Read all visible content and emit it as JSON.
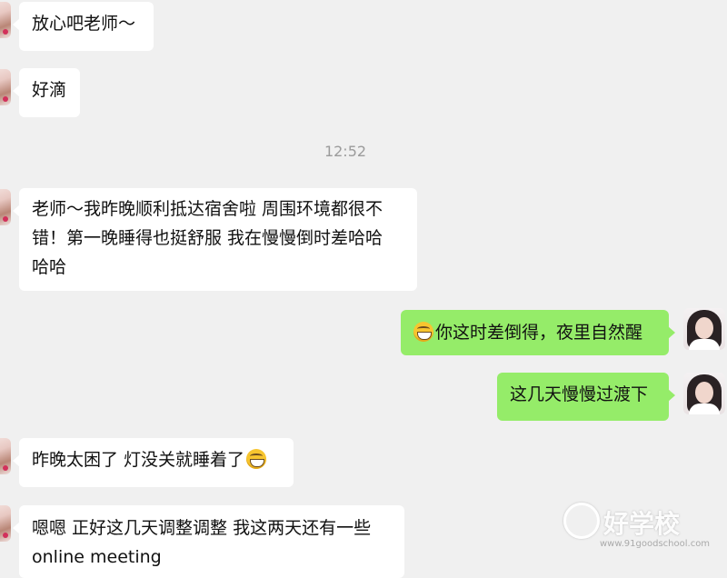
{
  "chat": {
    "timestamp": "12:52",
    "messages": [
      {
        "side": "left",
        "text": "放心吧老师～"
      },
      {
        "side": "left",
        "text": "好滴"
      },
      {
        "side": "left",
        "text_line1": "老师～我昨晚顺利抵达宿舍啦 周围环境都很不",
        "text_line2": "错！第一晚睡得也挺舒服 我在慢慢倒时差哈哈",
        "text_line3": "哈哈"
      },
      {
        "side": "right",
        "emoji": "grinning-face-emoji",
        "text": "你这时差倒得，夜里自然醒"
      },
      {
        "side": "right",
        "text": "这几天慢慢过渡下"
      },
      {
        "side": "left",
        "text": "昨晚太困了 灯没关就睡着了",
        "emoji": "grinning-face-emoji"
      },
      {
        "side": "left",
        "text_line1": "嗯嗯 正好这几天调整调整 我这两天还有一些",
        "text_line2": "online meeting"
      }
    ]
  },
  "colors": {
    "background": "#f0f0f0",
    "incoming_bubble": "#ffffff",
    "outgoing_bubble": "#95ec69",
    "timestamp": "#9b9b9b"
  },
  "watermark": {
    "brand": "好学校",
    "url": "www.91goodschool.com"
  }
}
